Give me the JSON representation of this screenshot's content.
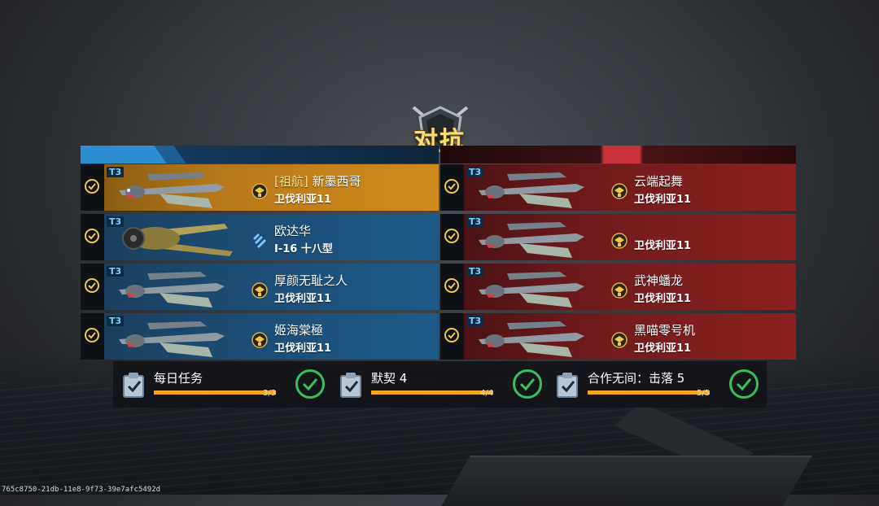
{
  "screen": {
    "title": "对抗",
    "build_id": "765c8750-21db-11e8-9f73-39e7afc5492d"
  },
  "teams": {
    "left": {
      "color": "#1d5a88",
      "players": [
        {
          "tier": "T3",
          "guild": "[祖航]",
          "name": "新墨西哥",
          "aircraft": "卫伐利亚11",
          "rank_icon": "wings-rank-icon",
          "highlight": true
        },
        {
          "tier": "T3",
          "guild": "",
          "name": "欧达华",
          "aircraft": "I-16 十八型",
          "rank_icon": "chevron-rank-icon",
          "highlight": false
        },
        {
          "tier": "T3",
          "guild": "",
          "name": "厚颜无耻之人",
          "aircraft": "卫伐利亚11",
          "rank_icon": "wings-rank-icon",
          "highlight": false
        },
        {
          "tier": "T3",
          "guild": "",
          "name": "姬海棠極",
          "aircraft": "卫伐利亚11",
          "rank_icon": "wings-rank-icon",
          "highlight": false
        }
      ]
    },
    "right": {
      "color": "#8b2120",
      "players": [
        {
          "tier": "T3",
          "guild": "",
          "name": "云端起舞",
          "aircraft": "卫伐利亚11",
          "rank_icon": "wings-rank-icon"
        },
        {
          "tier": "T3",
          "guild": "",
          "name": "",
          "aircraft": "卫伐利亚11",
          "rank_icon": "wings-rank-icon"
        },
        {
          "tier": "T3",
          "guild": "",
          "name": "武神蟠龙",
          "aircraft": "卫伐利亚11",
          "rank_icon": "wings-rank-icon"
        },
        {
          "tier": "T3",
          "guild": "",
          "name": "黑喵零号机",
          "aircraft": "卫伐利亚11",
          "rank_icon": "wings-rank-icon"
        }
      ]
    }
  },
  "quests": [
    {
      "label": "每日任务",
      "count": "3/3",
      "progress": 1.0,
      "icon": "clipboard-check-icon",
      "status_icon": "checkmark-circle-icon"
    },
    {
      "label": "默契 4",
      "count": "4/4",
      "progress": 1.0,
      "icon": "clipboard-check-icon",
      "status_icon": "checkmark-circle-icon"
    },
    {
      "label": "合作无间：击落 5",
      "count": "5/5",
      "progress": 1.0,
      "icon": "clipboard-check-icon",
      "status_icon": "checkmark-circle-icon"
    }
  ],
  "colors": {
    "accent_gold": "#f2c94c",
    "progress": "#f5a623",
    "complete_green": "#38c05a",
    "team_blue": "#2d8fd0",
    "team_red": "#c8323a"
  }
}
